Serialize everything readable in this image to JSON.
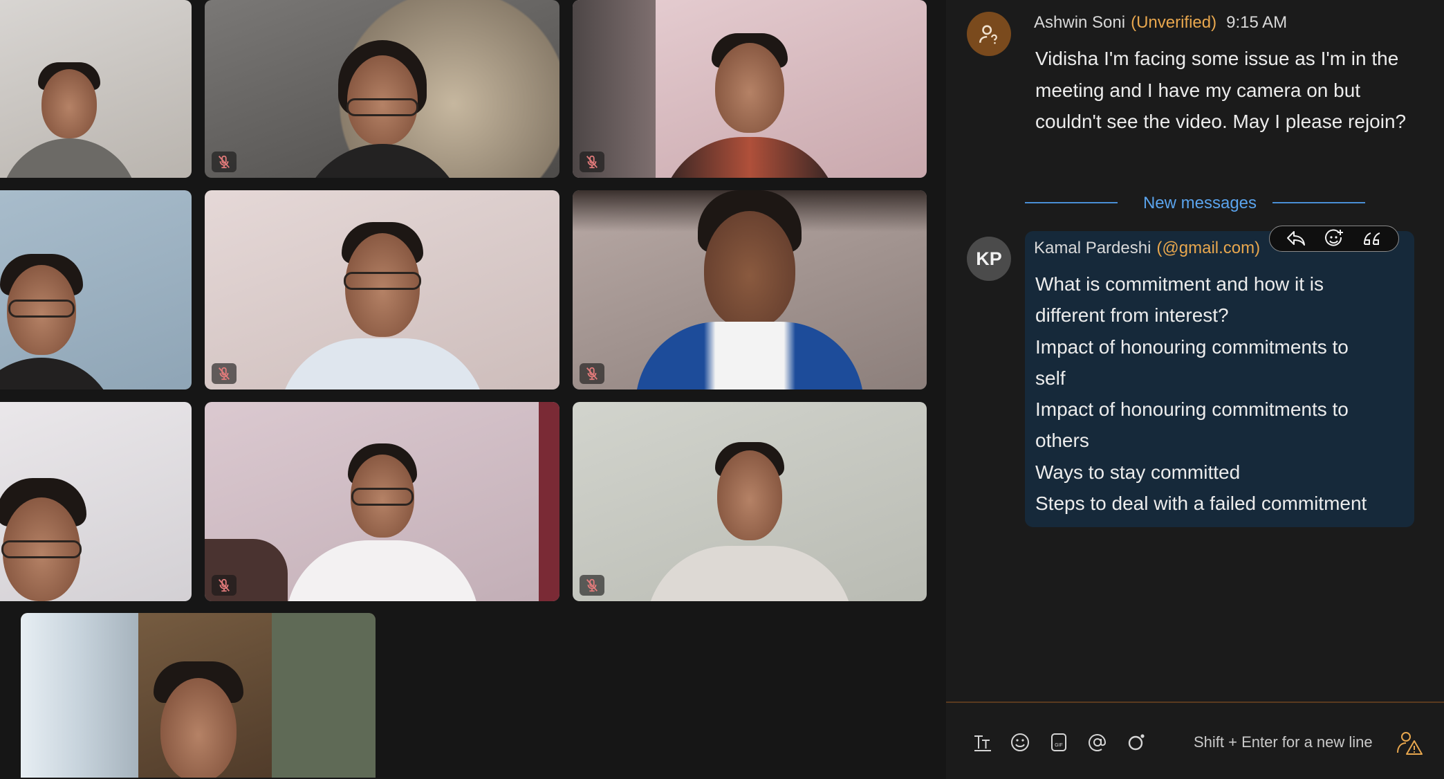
{
  "chat": {
    "message1": {
      "sender": "Ashwin Soni",
      "tag": "(Unverified)",
      "time": "9:15 AM",
      "text": "Vidisha I'm facing some issue as I'm in the meeting and I have my camera on but couldn't see the video. May I please rejoin?"
    },
    "new_messages_label": "New messages",
    "message2": {
      "avatar_initials": "KP",
      "sender": "Kamal Pardeshi",
      "tag": "(@gmail.com)",
      "lines": [
        "What is commitment and how it is",
        "different from interest?",
        "Impact of honouring commitments to",
        "self",
        "Impact of honouring commitments to",
        "others",
        "Ways to stay committed",
        "Steps to deal with a failed commitment"
      ]
    },
    "hover_actions": [
      "reply-icon",
      "add-reaction-icon",
      "quote-icon"
    ],
    "composer": {
      "hint": "Shift + Enter for a new line",
      "tools": [
        "text-format-icon",
        "emoji-icon",
        "gif-icon",
        "mention-icon",
        "record-icon"
      ]
    }
  },
  "colors": {
    "accent_orange": "#e8a74e",
    "new_messages_blue": "#5aa3ec",
    "bubble_bg": "#16293a",
    "chat_bg": "#1b1b1b",
    "gallery_bg": "#161616",
    "mute_icon": "#e37b7b"
  },
  "video_tiles": [
    {
      "id": "r1c1",
      "muted": false
    },
    {
      "id": "r1c2",
      "muted": true
    },
    {
      "id": "r1c3",
      "muted": true
    },
    {
      "id": "r2c1",
      "muted": false
    },
    {
      "id": "r2c2",
      "muted": true
    },
    {
      "id": "r2c3",
      "muted": true
    },
    {
      "id": "r3c1",
      "muted": false
    },
    {
      "id": "r3c2",
      "muted": true
    },
    {
      "id": "r3c3",
      "muted": true
    },
    {
      "id": "r4c1",
      "muted": false
    }
  ]
}
